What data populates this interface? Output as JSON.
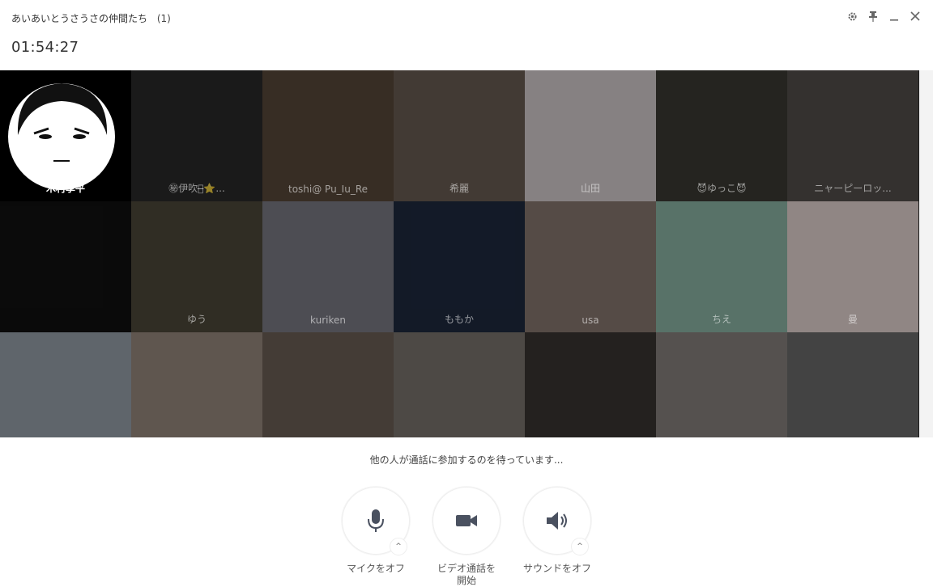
{
  "window": {
    "title": "あいあいとうさうさの仲間たち",
    "member_count": "(1)",
    "controls": [
      "gear-icon",
      "pin-icon",
      "minimize-icon",
      "close-icon"
    ]
  },
  "call": {
    "elapsed": "01:54:27",
    "status": "他の人が通話に参加するのを待っています..."
  },
  "participants": [
    {
      "name": "木村享平",
      "color": "#f0f0f0",
      "active": true
    },
    {
      "name": "㊙伊吹㊙̶⭐...",
      "color": "#2a2a2a"
    },
    {
      "name": "toshi@ Pu_Iu_Re",
      "color": "#5a4a3a"
    },
    {
      "name": "希麗",
      "color": "#6b5e55"
    },
    {
      "name": "山田",
      "color": "#d9d0d2"
    },
    {
      "name": "😈ゆっこ😈",
      "color": "#3c3a34"
    },
    {
      "name": "ニャーピーロッ...",
      "color": "#55504c"
    },
    {
      "name": "",
      "color": "#111111"
    },
    {
      "name": "ゆう",
      "color": "#4e4a3a"
    },
    {
      "name": "kuriken",
      "color": "#7d7d86"
    },
    {
      "name": "ももか",
      "color": "#1f2a40"
    },
    {
      "name": "usa",
      "color": "#8a7a72"
    },
    {
      "name": "ちえ",
      "color": "#8fb8a8"
    },
    {
      "name": "曼",
      "color": "#e8d8d6"
    },
    {
      "name": "",
      "color": "#9aa4ad"
    },
    {
      "name": "",
      "color": "#9a8c80"
    },
    {
      "name": "",
      "color": "#6e6258"
    },
    {
      "name": "",
      "color": "#7c7670"
    },
    {
      "name": "",
      "color": "#3a3632"
    },
    {
      "name": "",
      "color": "#8a8480"
    },
    {
      "name": "",
      "color": "#6c6c6c"
    }
  ],
  "controls": [
    {
      "label": "マイクをオフ",
      "icon": "microphone-icon",
      "has_menu": true
    },
    {
      "label": "ビデオ通話を開始",
      "icon": "video-camera-icon",
      "has_menu": false
    },
    {
      "label": "サウンドをオフ",
      "icon": "speaker-icon",
      "has_menu": true
    }
  ],
  "colors": {
    "icon": "#4a5160",
    "grid_background": "#1c1c1c"
  }
}
